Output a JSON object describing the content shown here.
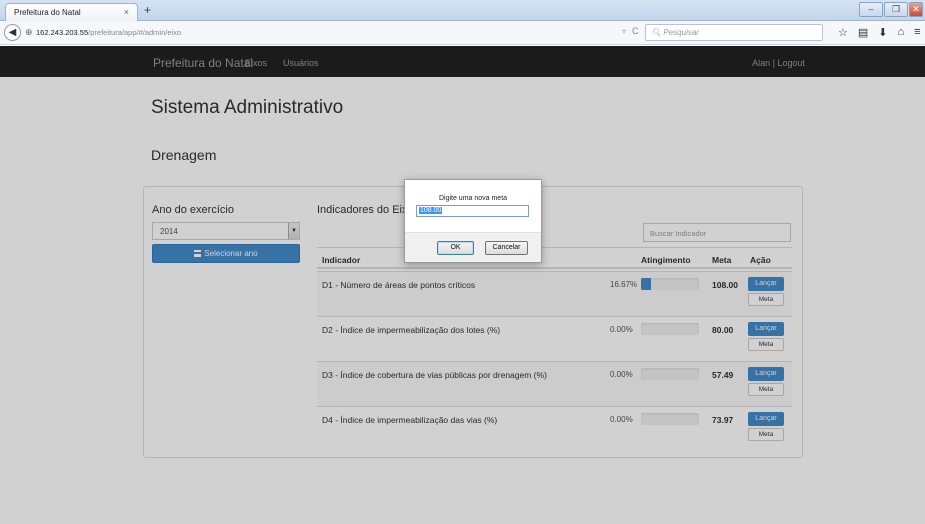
{
  "browser": {
    "tab_title": "Prefeitura do Natal",
    "tab_close": "×",
    "new_tab": "+",
    "identity": "⊕",
    "url_host": "162.243.203.55",
    "url_path": "/prefeitura/app/#/admin/eixo",
    "search_placeholder": "Pesquisar",
    "icons": [
      "star-icon",
      "bookmarks-icon",
      "download-icon",
      "home-icon",
      "menu-icon"
    ]
  },
  "app_nav": {
    "brand": "Prefeitura do Natal",
    "links": [
      "Eixos",
      "Usuários"
    ],
    "user": "Alan | Logout"
  },
  "page": {
    "title": "Sistema Administrativo",
    "subtitle": "Drenagem"
  },
  "sidebar": {
    "year_label": "Ano do exercício",
    "year_value": "2014",
    "select_button": "Selecionar ano"
  },
  "indicators": {
    "heading": "Indicadores do Eixo",
    "search_placeholder": "Buscar Indicador",
    "columns": [
      "Indicador",
      "Atingimento",
      "Meta",
      "Ação"
    ],
    "rows": [
      {
        "name": "D1 - Número de áreas de pontos críticos",
        "percent_text": "16.67%",
        "progress": 0.1667,
        "meta": "108.00",
        "launch": "Lançar",
        "meta_btn": "Meta"
      },
      {
        "name": "D2 - Índice de impermeabilização dos lotes (%)",
        "percent_text": "0.00%",
        "progress": 0,
        "meta": "80.00",
        "launch": "Lançar",
        "meta_btn": "Meta"
      },
      {
        "name": "D3 - Índice de cobertura de vias públicas por drenagem (%)",
        "percent_text": "0.00%",
        "progress": 0,
        "meta": "57.49",
        "launch": "Lançar",
        "meta_btn": "Meta"
      },
      {
        "name": "D4 - Índice de impermeabilização das vias (%)",
        "percent_text": "0.00%",
        "progress": 0,
        "meta": "73.97",
        "launch": "Lançar",
        "meta_btn": "Meta"
      }
    ]
  },
  "dialog": {
    "message": "Digite uma nova meta",
    "input_value": "108.00",
    "ok": "OK",
    "cancel": "Cancelar"
  },
  "colors": {
    "primary": "#428bca",
    "navbar": "#222222"
  }
}
